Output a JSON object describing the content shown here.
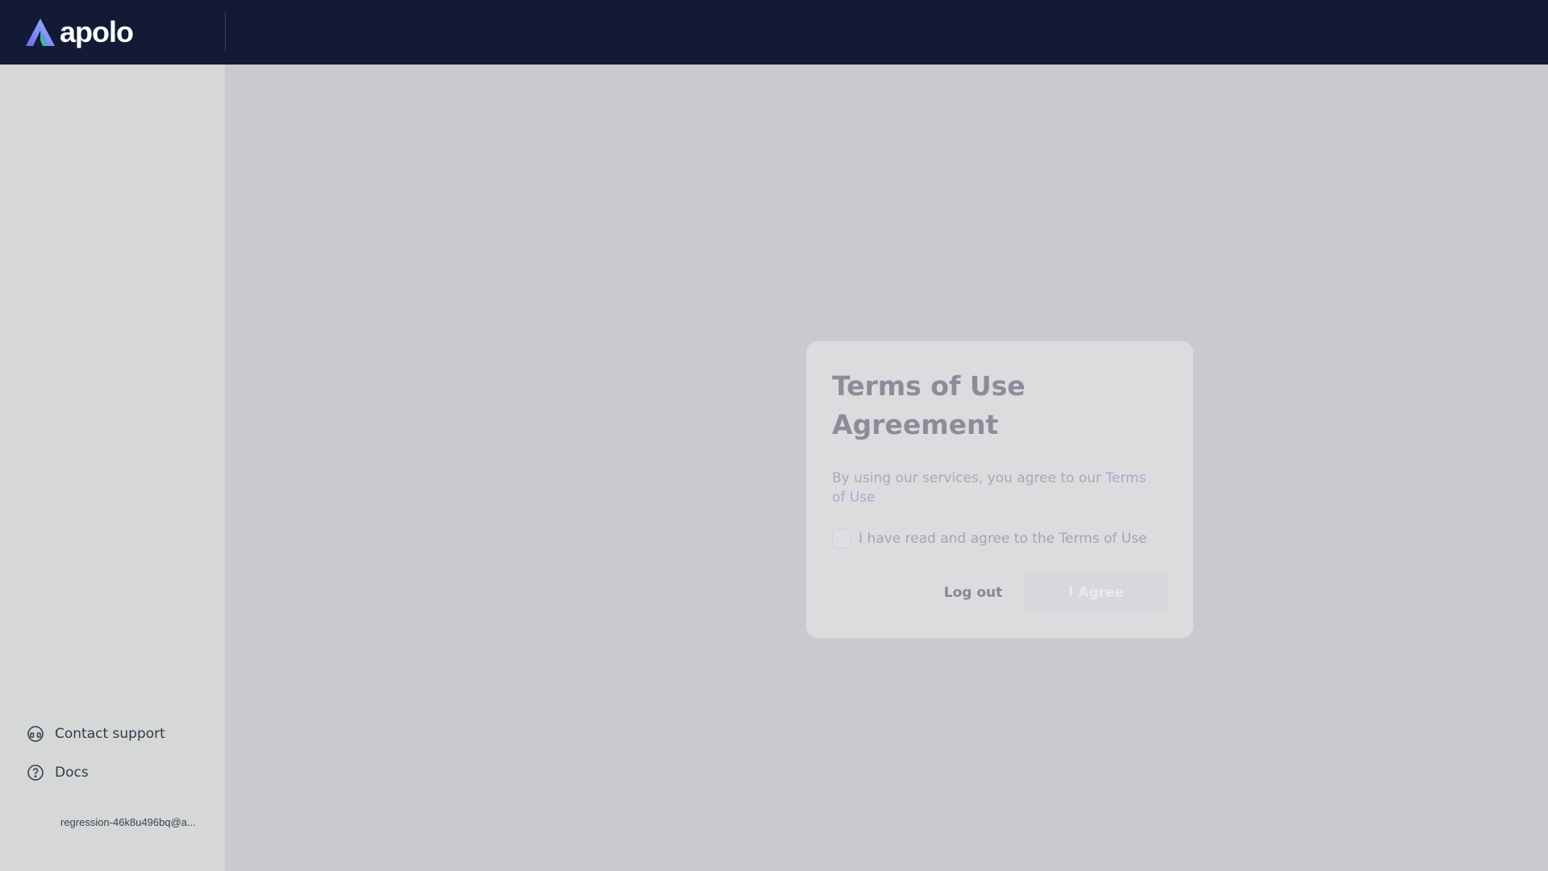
{
  "app": {
    "logo_text": "apolo",
    "logo_icon": "apolo-logo-icon"
  },
  "sidebar": {
    "links": [
      {
        "label": "Contact support",
        "icon": "headset-icon"
      },
      {
        "label": "Docs",
        "icon": "question-circle-icon"
      }
    ],
    "user_email": "regression-46k8u496bq@a..."
  },
  "modal": {
    "title": "Terms of Use Agreement",
    "text_prefix": "By using our services, you agree to our ",
    "text_link": "Terms of Use",
    "checkbox_label": "I have read and agree to the Terms of Use",
    "checkbox_checked": false,
    "logout_label": "Log out",
    "agree_label": "I Agree",
    "agree_disabled": true
  },
  "colors": {
    "topbar": "#121a35",
    "overlay": "#c9cacd",
    "accent_link": "#a6a9d2"
  }
}
